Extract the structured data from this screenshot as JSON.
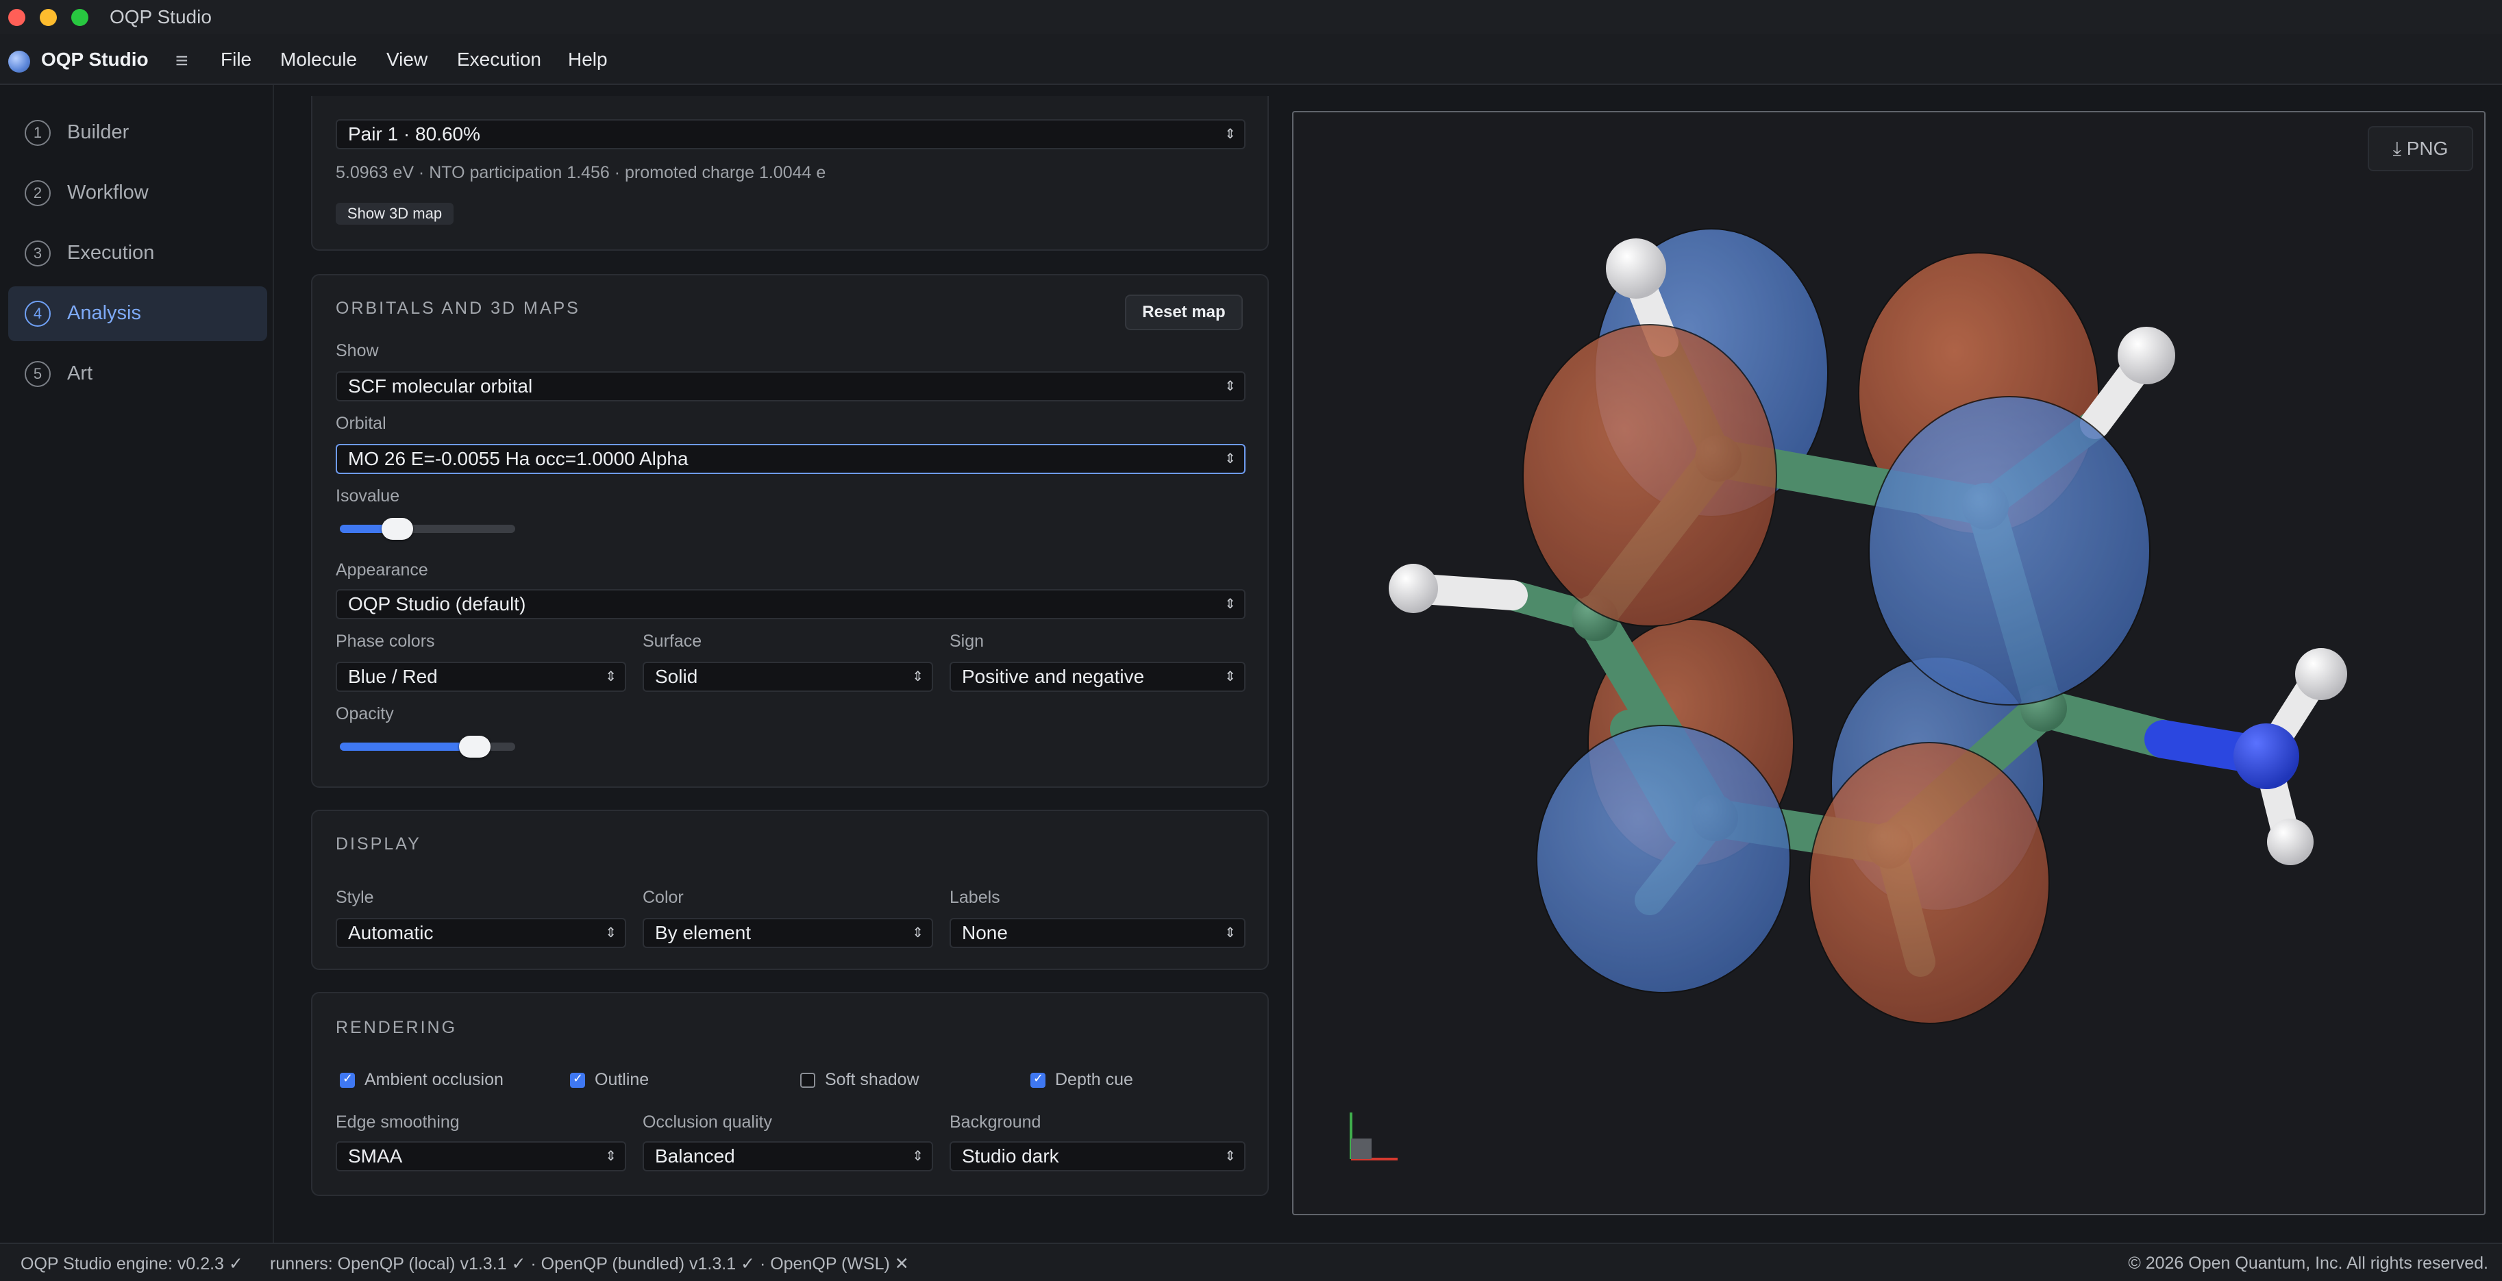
{
  "window": {
    "title": "OQP Studio"
  },
  "menubar": {
    "app_name": "OQP Studio",
    "items": [
      "File",
      "Molecule",
      "View",
      "Execution",
      "Help"
    ]
  },
  "sidebar": {
    "items": [
      {
        "num": "1",
        "label": "Builder"
      },
      {
        "num": "2",
        "label": "Workflow"
      },
      {
        "num": "3",
        "label": "Execution"
      },
      {
        "num": "4",
        "label": "Analysis",
        "active": true
      },
      {
        "num": "5",
        "label": "Art"
      }
    ]
  },
  "nto": {
    "pair_select": "Pair 1 · 80.60%",
    "info": "5.0963 eV · NTO participation 1.456 · promoted charge 1.0044 e",
    "show_map_button": "Show 3D map"
  },
  "orbitals": {
    "title": "ORBITALS AND 3D MAPS",
    "reset_button": "Reset map",
    "show_label": "Show",
    "show_value": "SCF molecular orbital",
    "orbital_label": "Orbital",
    "orbital_value": "MO 26 E=-0.0055 Ha occ=1.0000 Alpha",
    "isovalue_label": "Isovalue",
    "isovalue_level": 0.33,
    "appearance_label": "Appearance",
    "appearance_value": "OQP Studio (default)",
    "phase_label": "Phase colors",
    "phase_value": "Blue / Red",
    "surface_label": "Surface",
    "surface_value": "Solid",
    "sign_label": "Sign",
    "sign_value": "Positive and negative",
    "opacity_label": "Opacity",
    "opacity_level": 0.77
  },
  "display": {
    "title": "DISPLAY",
    "style_label": "Style",
    "style_value": "Automatic",
    "color_label": "Color",
    "color_value": "By element",
    "labels_label": "Labels",
    "labels_value": "None"
  },
  "rendering": {
    "title": "RENDERING",
    "checks": [
      {
        "label": "Ambient occlusion",
        "checked": true
      },
      {
        "label": "Outline",
        "checked": true
      },
      {
        "label": "Soft shadow",
        "checked": false
      },
      {
        "label": "Depth cue",
        "checked": true
      }
    ],
    "edge_label": "Edge smoothing",
    "edge_value": "SMAA",
    "occlusion_label": "Occlusion quality",
    "occlusion_value": "Balanced",
    "background_label": "Background",
    "background_value": "Studio dark"
  },
  "viewer": {
    "png_button": "⤓ PNG"
  },
  "status": {
    "engine": "OQP Studio engine: v0.2.3 ✓",
    "runners": "runners: OpenQP (local) v1.3.1 ✓ · OpenQP (bundled) v1.3.1 ✓ · OpenQP (WSL) ✕",
    "copyright": "© 2026 Open Quantum, Inc. All rights reserved."
  },
  "colors": {
    "accent": "#3f78f2",
    "lobe_positive": "#4f77b8",
    "lobe_negative": "#b35f42",
    "carbon": "#4e8b6a",
    "nitrogen": "#2b47e0",
    "hydrogen": "#e9e9ea"
  }
}
